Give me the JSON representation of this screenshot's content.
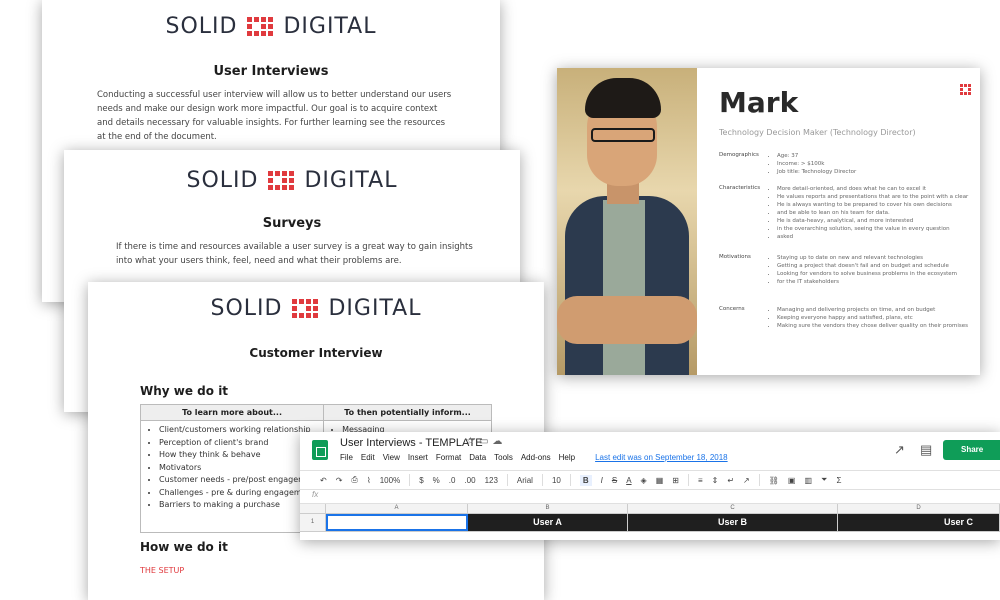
{
  "brand": {
    "left": "SOLID",
    "right": "DIGITAL",
    "accent": "#e03a3e"
  },
  "doc1": {
    "title": "User Interviews",
    "body": "Conducting a successful user interview will allow us to better understand our users needs and make our design work more impactful. Our goal is to acquire context and details necessary for valuable insights. For further learning see the resources at the end of the document."
  },
  "doc2": {
    "title": "Surveys",
    "body": "If there is time and resources available a user survey is a great way to gain insights into what your users think, feel, need and what their problems are."
  },
  "doc3": {
    "title": "Customer Interview",
    "why_heading": "Why we do it",
    "table": {
      "col1_header": "To learn more about...",
      "col2_header": "To then potentially inform...",
      "col1_items": [
        "Client/customers working relationship",
        "Perception of client's brand",
        "How they think & behave",
        "Motivators",
        "Customer needs - pre/post engagement",
        "Challenges - pre & during engagement",
        "Barriers to making a purchase"
      ],
      "col2_items": [
        "Messaging"
      ]
    },
    "how_heading": "How we do it",
    "setup_label": "THE SETUP"
  },
  "persona": {
    "name": "Mark",
    "role": "Technology Decision Maker (Technology Director)",
    "sections": [
      {
        "label": "Demographics",
        "items": [
          "Age: 37",
          "Income: > $100k",
          "Job title: Technology Director"
        ]
      },
      {
        "label": "Characteristics",
        "items": [
          "More detail-oriented, and does what he can to excel it",
          "He values reports and presentations that are to the point with a clear",
          "He is always wanting to be prepared to cover his own decisions",
          "and be able to lean on his team for data.",
          "He is data-heavy, analytical, and more interested",
          "in the overarching solution, seeing the value in every question",
          "asked"
        ]
      },
      {
        "label": "Motivations",
        "items": [
          "Staying up to date on new and relevant technologies",
          "Getting a project that doesn't fail and on budget and schedule",
          "Looking for vendors to solve business problems in the ecosystem",
          "for the IT stakeholders"
        ]
      },
      {
        "label": "Concerns",
        "items": [
          "Managing and delivering projects on time, and on budget",
          "Keeping everyone happy and satisfied, plans, etc",
          "Making sure the vendors they chose deliver quality on their promises"
        ]
      }
    ]
  },
  "sheet": {
    "title": "User Interviews - TEMPLATE",
    "menu": [
      "File",
      "Edit",
      "View",
      "Insert",
      "Format",
      "Data",
      "Tools",
      "Add-ons",
      "Help"
    ],
    "last_edit": "Last edit was on September 18, 2018",
    "share_label": "Share",
    "toolbar": {
      "zoom": "100%",
      "currency": "$",
      "percent": "%",
      "dec_less": ".0",
      "dec_more": ".00",
      "format_more": "123",
      "font": "Arial",
      "size": "10",
      "bold": "B",
      "italic": "I",
      "strike": "S",
      "text_color": "A"
    },
    "fx": "fx",
    "columns": [
      "A",
      "B",
      "C",
      "D"
    ],
    "row_number": "1",
    "row1": [
      "",
      "User A",
      "User B",
      "User C"
    ]
  }
}
